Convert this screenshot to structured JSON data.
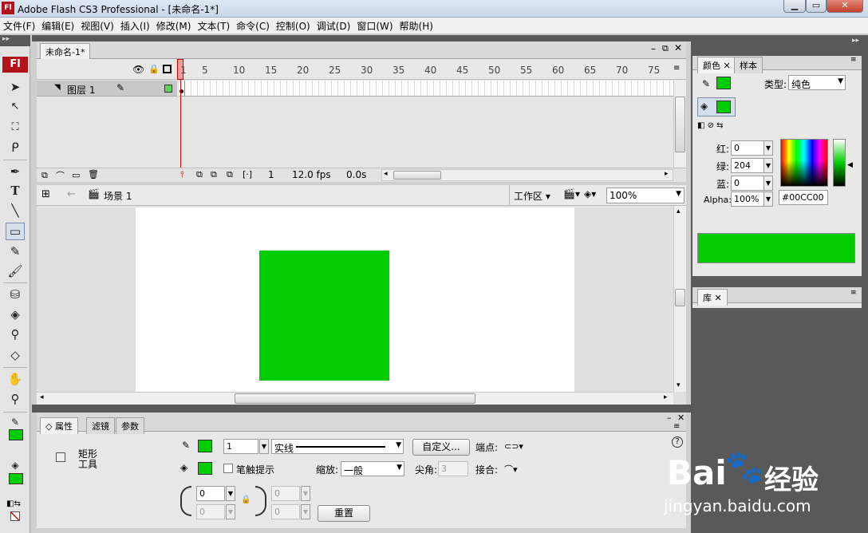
{
  "window": {
    "title": "Adobe Flash CS3 Professional - [未命名-1*]",
    "app_icon": "Fl"
  },
  "menu": [
    "文件(F)",
    "编辑(E)",
    "视图(V)",
    "插入(I)",
    "修改(M)",
    "文本(T)",
    "命令(C)",
    "控制(O)",
    "调试(D)",
    "窗口(W)",
    "帮助(H)"
  ],
  "document_tab": "未命名-1*",
  "timeline": {
    "frame_numbers": [
      "1",
      "5",
      "10",
      "15",
      "20",
      "25",
      "30",
      "35",
      "40",
      "45",
      "50",
      "55",
      "60",
      "65",
      "70",
      "75"
    ],
    "layer_name": "图层 1",
    "current_frame": "1",
    "fps": "12.0 fps",
    "time": "0.0s"
  },
  "edit_bar": {
    "scene": "场景 1",
    "workspace": "工作区",
    "zoom": "100%"
  },
  "tools_logo": "Fl",
  "properties": {
    "tabs": [
      "属性",
      "滤镜",
      "参数"
    ],
    "tool_name": "矩形\n工具",
    "stroke_width": "1",
    "stroke_style": "实线",
    "custom_button": "自定义...",
    "cap_label": "端点:",
    "hinting_label": "笔触提示",
    "scale_label": "缩放:",
    "scale_value": "一般",
    "miter_label": "尖角:",
    "miter_value": "3",
    "join_label": "接合:",
    "corner1": "0",
    "corner2": "0",
    "corner3": "0",
    "corner4": "0",
    "reset_button": "重置",
    "help": "?"
  },
  "color_panel": {
    "tabs": [
      "颜色",
      "样本"
    ],
    "type_label": "类型:",
    "type_value": "纯色",
    "red_label": "红:",
    "red_value": "0",
    "green_label": "绿:",
    "green_value": "204",
    "blue_label": "蓝:",
    "blue_value": "0",
    "alpha_label": "Alpha:",
    "alpha_value": "100%",
    "hex_value": "#00CC00"
  },
  "library_panel": {
    "tab": "库"
  },
  "colors": {
    "fill": "#00cc00",
    "stroke": "#00cc00",
    "stage": "#ffffff"
  },
  "watermark": {
    "brand": "Bai",
    "brand2": "经验",
    "url": "jingyan.baidu.com"
  }
}
